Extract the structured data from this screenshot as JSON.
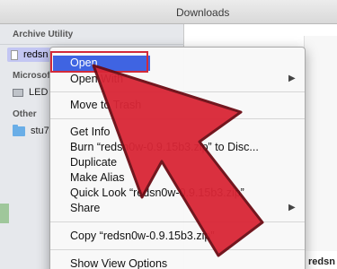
{
  "window": {
    "title": "Downloads"
  },
  "sidebar": {
    "section_archive": "Archive Utility",
    "selected_item": "redsn",
    "section_devices": "Microsof",
    "device_item": "LED",
    "section_other": "Other",
    "other_item": "stu7"
  },
  "context_menu": {
    "open": "Open",
    "open_with": "Open With",
    "move_to_trash": "Move to Trash",
    "get_info": "Get Info",
    "burn": "Burn “redsn0w-0.9.15b3.zip” to Disc...",
    "duplicate": "Duplicate",
    "make_alias": "Make Alias",
    "quick_look": "Quick Look “redsn0w-0.9.15b3.zip”",
    "share": "Share",
    "copy": "Copy “redsn0w-0.9.15b3.zip”",
    "show_view_options": "Show View Options"
  },
  "right_pane": {
    "bottom_text": "redsn"
  },
  "colors": {
    "highlight": "#3f64e2",
    "annotation_red": "#d22a3a"
  }
}
